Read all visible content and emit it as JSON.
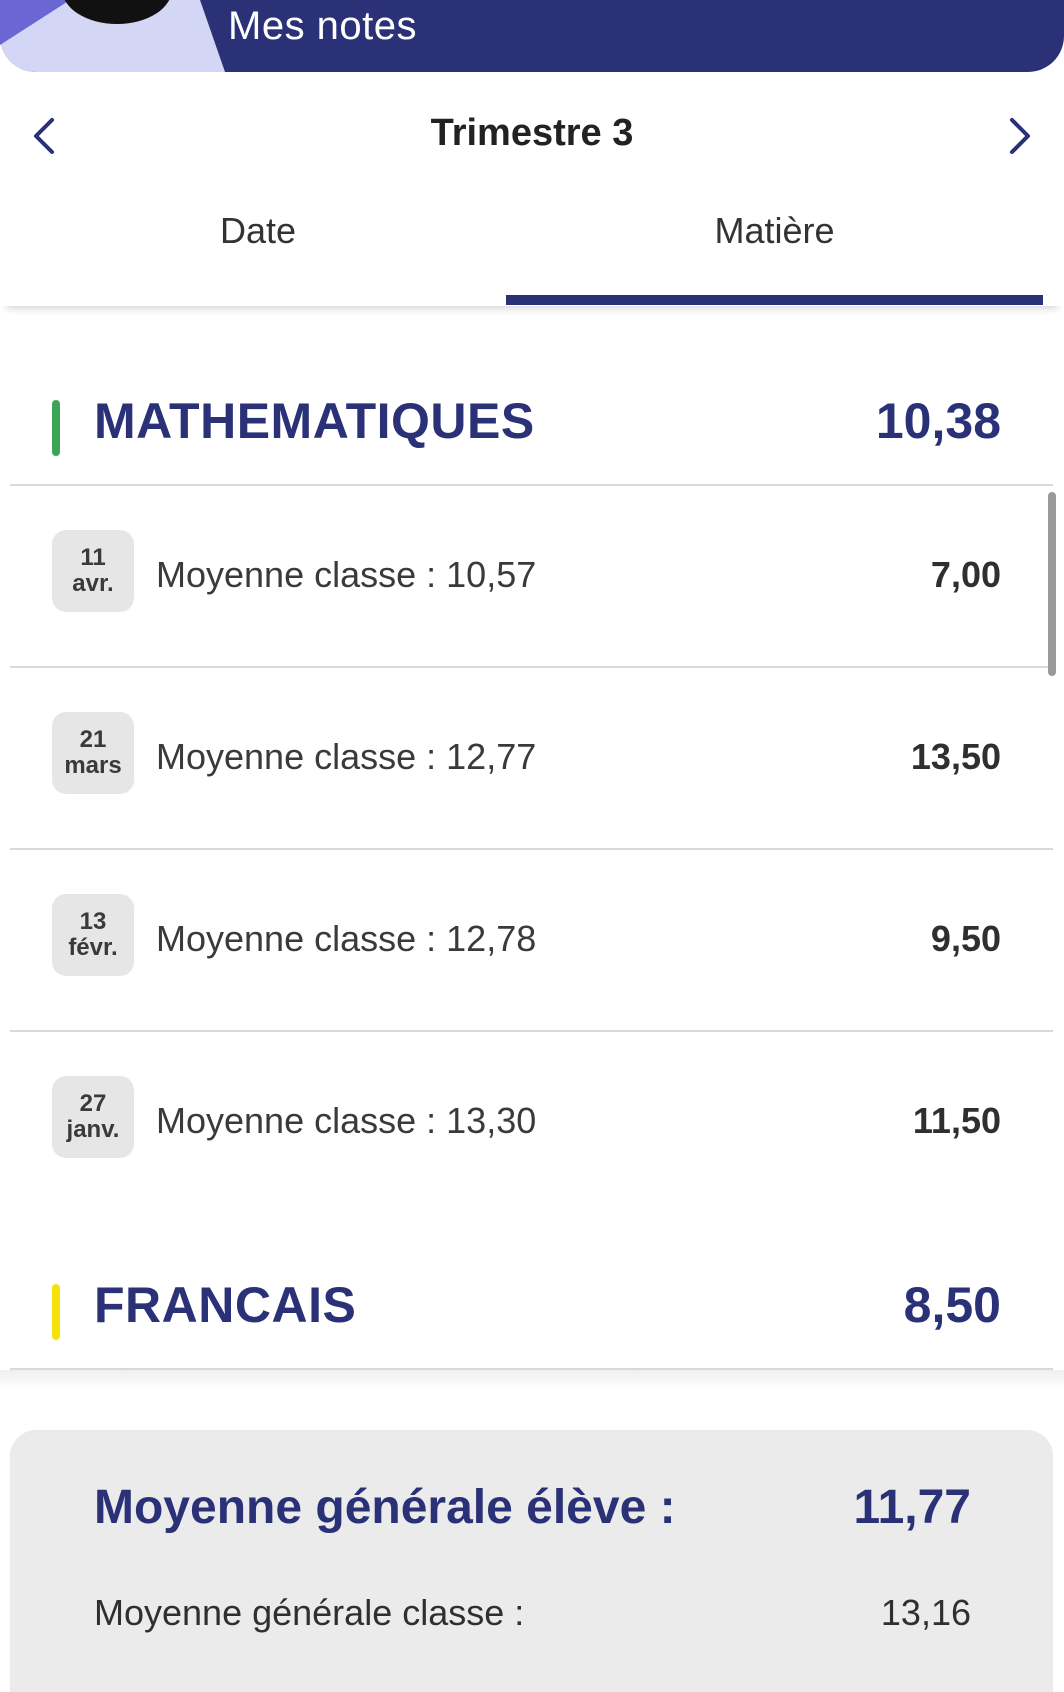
{
  "header": {
    "title": "Mes notes"
  },
  "term": {
    "title": "Trimestre 3"
  },
  "tabs": [
    {
      "label": "Date",
      "selected": false
    },
    {
      "label": "Matière",
      "selected": true
    }
  ],
  "subjects": [
    {
      "name": "MATHEMATIQUES",
      "average": "10,38",
      "color": "#3aa655",
      "grades": [
        {
          "day": "11",
          "month": "avr.",
          "label": "Moyenne classe : 10,57",
          "value": "7,00"
        },
        {
          "day": "21",
          "month": "mars",
          "label": "Moyenne classe : 12,77",
          "value": "13,50"
        },
        {
          "day": "13",
          "month": "févr.",
          "label": "Moyenne classe : 12,78",
          "value": "9,50"
        },
        {
          "day": "27",
          "month": "janv.",
          "label": "Moyenne classe : 13,30",
          "value": "11,50"
        }
      ]
    },
    {
      "name": "FRANCAIS",
      "average": "8,50",
      "color": "#f5e20a"
    }
  ],
  "summary": {
    "student_label": "Moyenne générale élève :",
    "student_value": "11,77",
    "class_label": "Moyenne générale classe :",
    "class_value": "13,16"
  },
  "colors": {
    "primary": "#2a3177",
    "accent_light": "#d4d6f6"
  }
}
